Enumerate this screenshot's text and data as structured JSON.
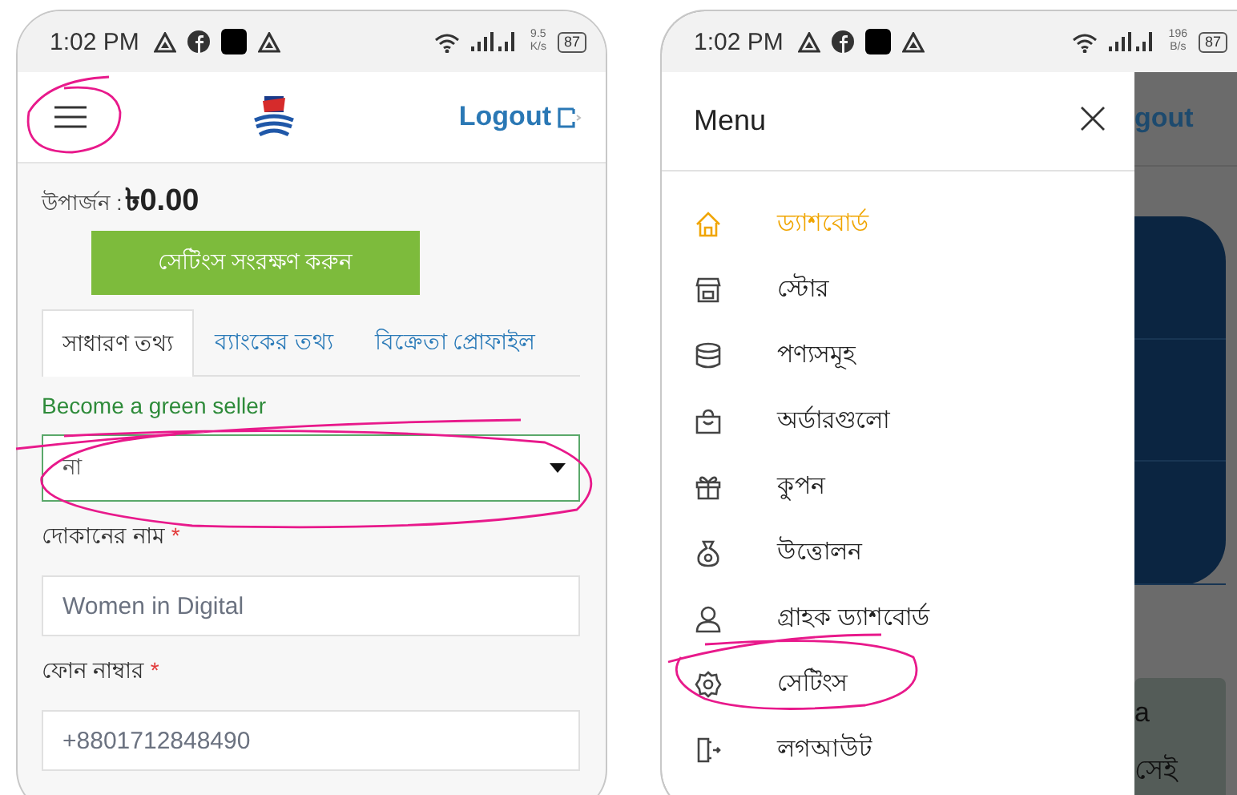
{
  "left_screen": {
    "status_bar": {
      "time": "1:02 PM",
      "speed_value": "9.5",
      "speed_unit": "K/s",
      "battery": "87"
    },
    "header": {
      "logout": "Logout"
    },
    "earnings": {
      "label": "উপার্জন :",
      "amount": "৳0.00"
    },
    "save_button": "সেটিংস সংরক্ষণ করুন",
    "tabs": [
      {
        "label": "সাধারণ তথ্য",
        "selected": true
      },
      {
        "label": "ব্যাংকের তথ্য",
        "selected": false
      },
      {
        "label": "বিক্রেতা প্রোফাইল",
        "selected": false
      }
    ],
    "green_seller": {
      "label": "Become a green seller",
      "value": "না"
    },
    "fields": [
      {
        "label": "দোকানের নাম",
        "required_mark": "*",
        "value": "Women in Digital"
      },
      {
        "label": "ফোন নাম্বার",
        "required_mark": "*",
        "value": "+8801712848490"
      }
    ]
  },
  "right_screen": {
    "status_bar": {
      "time": "1:02 PM",
      "speed_value": "196",
      "speed_unit": "B/s",
      "battery": "87"
    },
    "menu": {
      "title": "Menu",
      "items": [
        {
          "label": "ড্যাশবোর্ড",
          "selected": true
        },
        {
          "label": "স্টোর",
          "selected": false
        },
        {
          "label": "পণ্যসমূহ",
          "selected": false
        },
        {
          "label": "অর্ডারগুলো",
          "selected": false
        },
        {
          "label": "কুপন",
          "selected": false
        },
        {
          "label": "উত্তোলন",
          "selected": false
        },
        {
          "label": "গ্রাহক ড্যাশবোর্ড",
          "selected": false
        },
        {
          "label": "সেটিংস",
          "selected": false
        },
        {
          "label": "লগআউট",
          "selected": false
        }
      ]
    },
    "background": {
      "logout_fragment": "gout",
      "texts": [
        "a",
        "সেই"
      ]
    }
  }
}
